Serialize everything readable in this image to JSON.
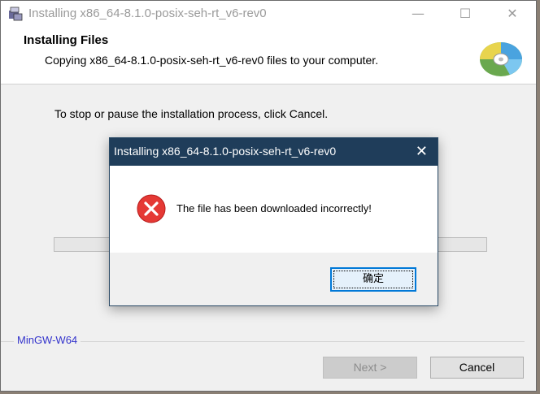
{
  "window": {
    "title": "Installing x86_64-8.1.0-posix-seh-rt_v6-rev0",
    "controls": {
      "minimize": "—",
      "maximize": "☐",
      "close": "✕"
    }
  },
  "header": {
    "title": "Installing Files",
    "subtitle": "Copying x86_64-8.1.0-posix-seh-rt_v6-rev0 files to your computer.",
    "icon": "cd-disc-icon"
  },
  "body": {
    "instruction": "To stop or pause the installation process, click Cancel."
  },
  "progress": {
    "value": 0
  },
  "brand": "MinGW-W64",
  "buttons": {
    "next": "Next >",
    "cancel": "Cancel"
  },
  "dialog": {
    "title": "Installing x86_64-8.1.0-posix-seh-rt_v6-rev0",
    "close": "✕",
    "icon": "error-icon",
    "message": "The file has been downloaded incorrectly!",
    "ok": "确定"
  },
  "colors": {
    "dialog_titlebar": "#1f3d5a",
    "error": "#e53935",
    "brand": "#3333cc"
  }
}
